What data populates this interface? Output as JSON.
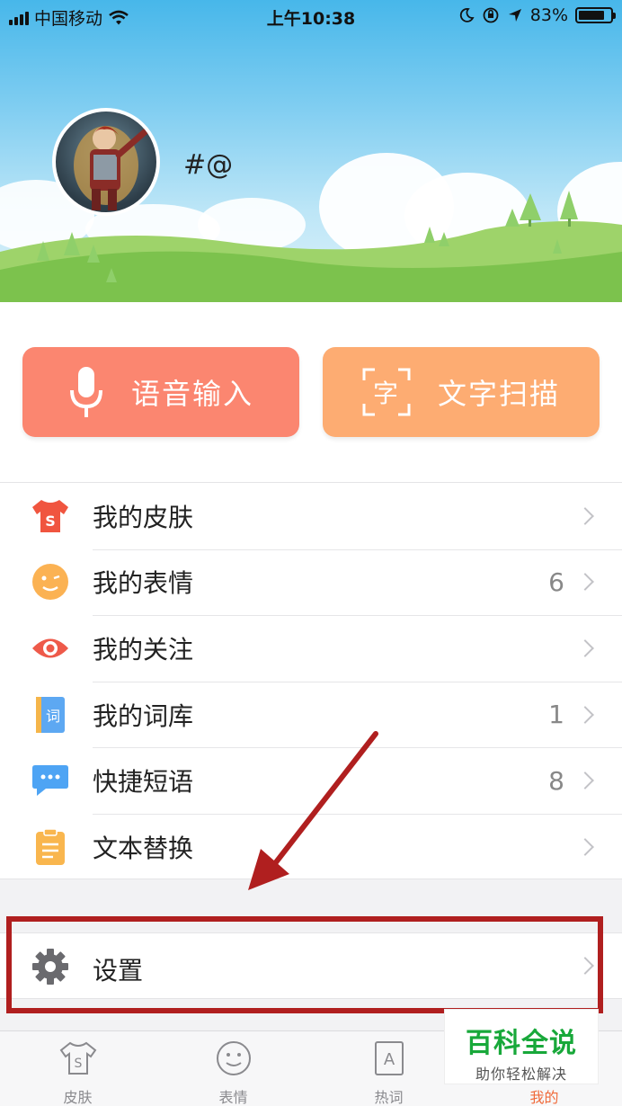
{
  "status_bar": {
    "carrier": "中国移动",
    "time": "上午10:38",
    "battery_text": "83%",
    "battery_level": 0.83
  },
  "profile": {
    "username": "#@"
  },
  "quick_actions": [
    {
      "label": "语音输入",
      "icon": "microphone-icon",
      "color": "#fb8670"
    },
    {
      "label": "文字扫描",
      "icon": "scan-text-icon",
      "color": "#fdac72"
    }
  ],
  "menu": {
    "items": [
      {
        "label": "我的皮肤",
        "count": "",
        "icon": "skin-shirt-icon"
      },
      {
        "label": "我的表情",
        "count": "6",
        "icon": "emoji-face-icon"
      },
      {
        "label": "我的关注",
        "count": "",
        "icon": "eye-icon"
      },
      {
        "label": "我的词库",
        "count": "1",
        "icon": "dictionary-book-icon"
      },
      {
        "label": "快捷短语",
        "count": "8",
        "icon": "chat-bubble-icon"
      },
      {
        "label": "文本替换",
        "count": "",
        "icon": "clipboard-icon"
      }
    ]
  },
  "settings": {
    "label": "设置",
    "icon": "gear-icon"
  },
  "tabbar": {
    "tabs": [
      {
        "label": "皮肤",
        "icon": "shirt-tab-icon"
      },
      {
        "label": "表情",
        "icon": "smiley-tab-icon"
      },
      {
        "label": "热词",
        "icon": "hotword-tab-icon"
      },
      {
        "label": "我的",
        "icon": "profile-tab-icon",
        "active": true
      }
    ]
  },
  "watermark": {
    "title": "百科全说",
    "subtitle": "助你轻松解决"
  },
  "colors": {
    "accent": "#f06a3a",
    "highlight_box": "#b01f1f",
    "arrow": "#b01f1f"
  }
}
